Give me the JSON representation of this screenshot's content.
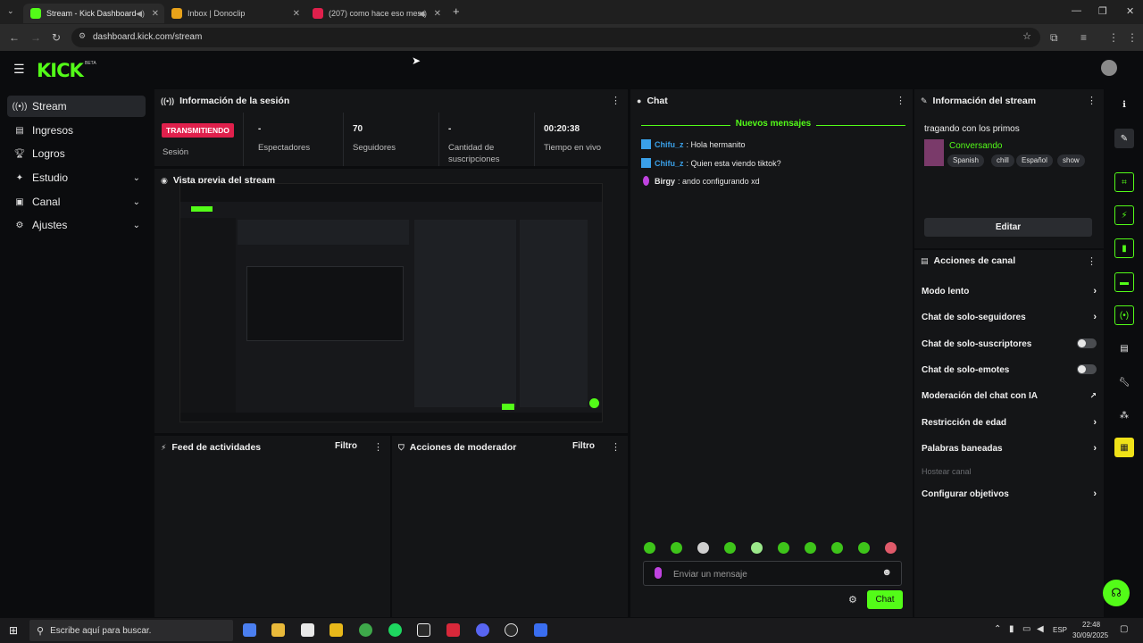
{
  "browser": {
    "tabs": [
      {
        "title": "Stream - Kick Dashboard",
        "active": true
      },
      {
        "title": "Inbox | Donoclip",
        "active": false
      },
      {
        "title": "(207) como hace eso mess",
        "active": false
      }
    ],
    "url": "dashboard.kick.com/stream"
  },
  "kick": {
    "logo": "KICK",
    "beta": "BETA"
  },
  "sidebar": {
    "items": [
      {
        "label": "Stream",
        "icon": "broadcast-icon"
      },
      {
        "label": "Ingresos",
        "icon": "money-icon"
      },
      {
        "label": "Logros",
        "icon": "trophy-icon"
      },
      {
        "label": "Estudio",
        "icon": "studio-icon"
      },
      {
        "label": "Canal",
        "icon": "channel-icon"
      },
      {
        "label": "Ajustes",
        "icon": "gear-icon"
      }
    ]
  },
  "session": {
    "title": "Información de la sesión",
    "badge": "TRANSMITIENDO",
    "session_label": "Sesión",
    "viewers_value": "-",
    "viewers_label": "Espectadores",
    "followers_value": "70",
    "followers_label": "Seguidores",
    "subs_value": "-",
    "subs_label": "Cantidad de suscripciones",
    "uptime_value": "00:20:38",
    "uptime_label": "Tiempo en vivo"
  },
  "preview": {
    "title": "Vista previa del stream"
  },
  "activity": {
    "title": "Feed de actividades",
    "filter": "Filtro"
  },
  "modactions": {
    "title": "Acciones de moderador",
    "filter": "Filtro"
  },
  "chat": {
    "title": "Chat",
    "new_messages": "Nuevos mensajes",
    "messages": [
      {
        "user": "Chifu_z",
        "text": "Hola hermanito",
        "color": "#3aa0e8"
      },
      {
        "user": "Chifu_z",
        "text": "Quien esta viendo tiktok?",
        "color": "#3aa0e8"
      },
      {
        "user": "Birgy",
        "text": "ando configurando xd",
        "color": "#e8e8e8"
      }
    ],
    "placeholder": "Enviar un mensaje",
    "send": "Chat"
  },
  "streaminfo": {
    "title": "Información del stream",
    "stream_title": "tragando con los primos",
    "category": "Conversando",
    "tags": [
      "Spanish",
      "chill",
      "Español",
      "show"
    ],
    "edit": "Editar"
  },
  "channelactions": {
    "title": "Acciones de canal",
    "items": [
      {
        "label": "Modo lento",
        "type": "arrow"
      },
      {
        "label": "Chat de solo-seguidores",
        "type": "arrow"
      },
      {
        "label": "Chat de solo-suscriptores",
        "type": "toggle"
      },
      {
        "label": "Chat de solo-emotes",
        "type": "toggle"
      },
      {
        "label": "Moderación del chat con IA",
        "type": "external"
      },
      {
        "label": "Restricción de edad",
        "type": "arrow"
      },
      {
        "label": "Palabras baneadas",
        "type": "arrow"
      },
      {
        "label": "Hostear canal",
        "type": "disabled"
      },
      {
        "label": "Configurar objetivos",
        "type": "arrow"
      }
    ]
  },
  "taskbar": {
    "search": "Escribe aquí para buscar.",
    "lang": "ESP",
    "time": "22:48",
    "date": "30/09/2025"
  },
  "colors": {
    "accent": "#53fc18",
    "live": "#e0204c"
  }
}
